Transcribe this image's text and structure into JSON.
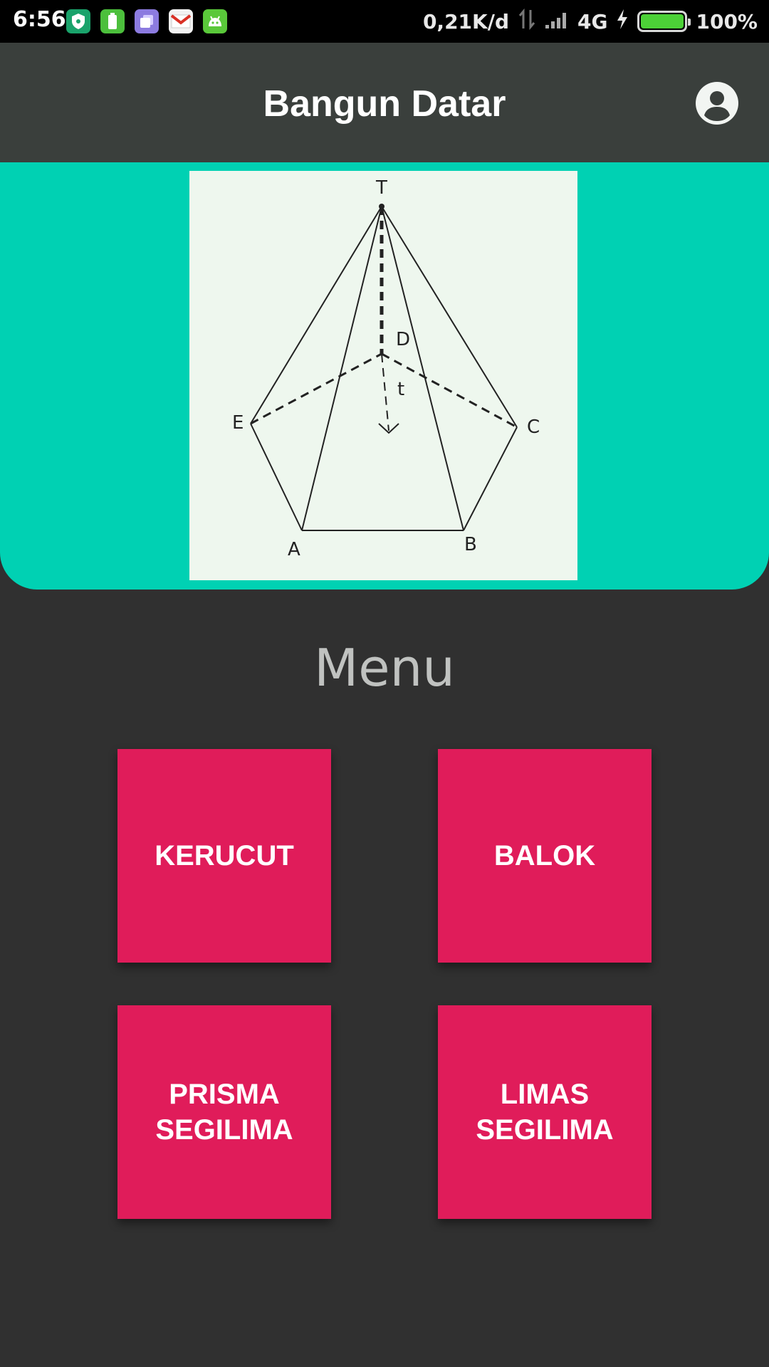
{
  "status_bar": {
    "time": "6:56",
    "network_speed": "0,21K/d",
    "network_type": "4G",
    "battery_level": "100%",
    "icons": [
      "shield-app-icon",
      "battery-app-icon",
      "purple-app-icon",
      "gmail-icon",
      "green-android-icon",
      "data-arrows-icon",
      "signal-icon",
      "charging-icon",
      "battery-icon"
    ],
    "battery_color": "#4cd137"
  },
  "app_bar": {
    "title": "Bangun Datar",
    "account_icon": "account-circle-icon",
    "background": "#3a3f3c"
  },
  "hero": {
    "background": "#00d1b3",
    "diagram_labels": {
      "apex": "T",
      "center": "D",
      "height": "t",
      "vertex_e": "E",
      "vertex_c": "C",
      "vertex_a": "A",
      "vertex_b": "B"
    }
  },
  "menu": {
    "heading": "Menu",
    "button_color": "#e01c5a",
    "buttons": [
      {
        "label": "KERUCUT"
      },
      {
        "label": "BALOK"
      },
      {
        "label": "PRISMA\nSEGILIMA"
      },
      {
        "label": "LIMAS\nSEGILIMA"
      }
    ]
  }
}
